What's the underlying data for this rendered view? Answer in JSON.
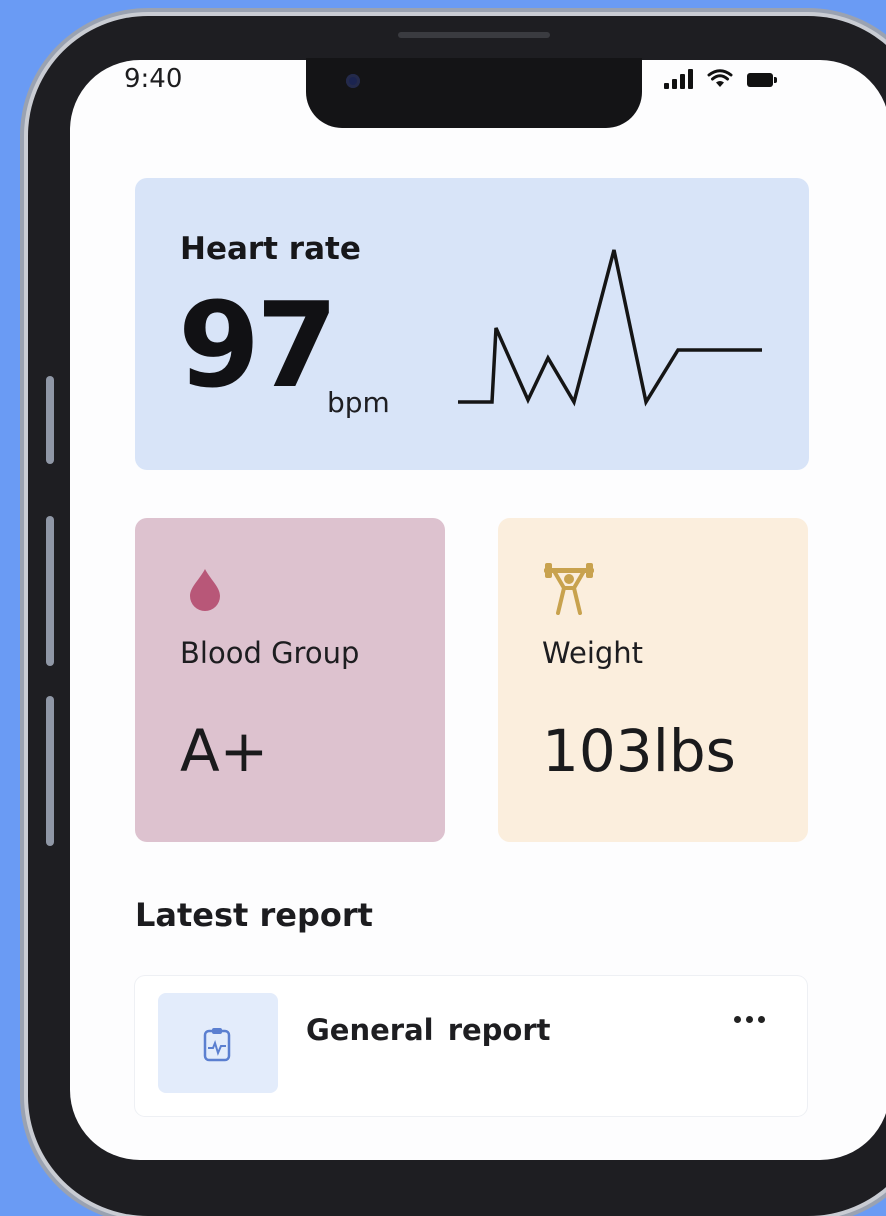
{
  "status_bar": {
    "time": "9:40",
    "icons": [
      "signal-icon",
      "wifi-icon",
      "battery-icon"
    ]
  },
  "heart_rate": {
    "title": "Heart rate",
    "value": "97",
    "unit": "bpm",
    "chart_icon": "ecg-line-icon"
  },
  "tiles": [
    {
      "icon": "blood-drop-icon",
      "label": "Blood Group",
      "value": "A+"
    },
    {
      "icon": "weightlifter-icon",
      "label": "Weight",
      "value": "103lbs"
    }
  ],
  "latest_report": {
    "section_title": "Latest report",
    "items": [
      {
        "icon": "report-document-icon",
        "title": "General  report",
        "menu_icon": "more-dots-icon"
      }
    ]
  },
  "colors": {
    "background": "#6a9bf4",
    "heart_card": "#d8e4f8",
    "blood_card": "#ddc2cf",
    "weight_card": "#fbeedd",
    "blood_drop": "#b85778",
    "weight_icon": "#c8a24e"
  }
}
